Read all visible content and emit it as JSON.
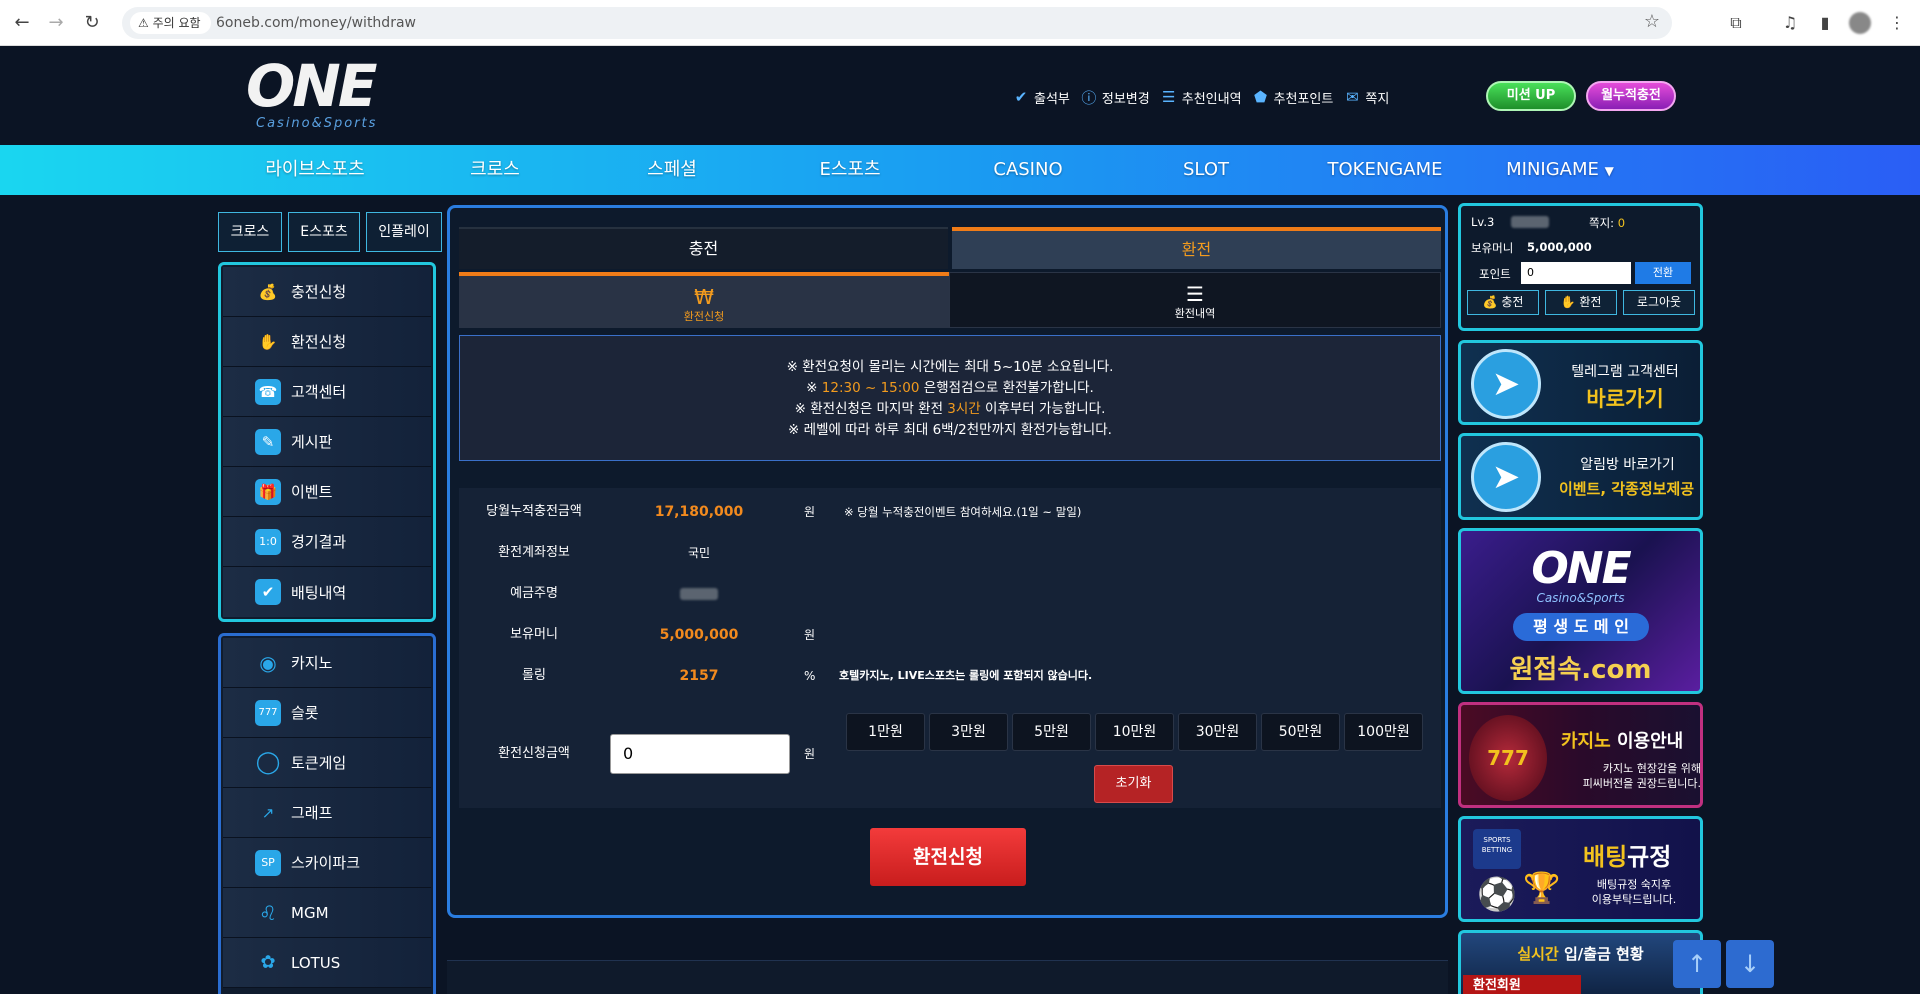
{
  "browser": {
    "warning": "주의 요함",
    "url": "6oneb.com/money/withdraw"
  },
  "logo": {
    "brand": "ONE",
    "tagline": "Casino&Sports"
  },
  "toplinks": [
    {
      "label": "출석부",
      "icon": "check-circle-icon"
    },
    {
      "label": "정보변경",
      "icon": "info-icon"
    },
    {
      "label": "추천인내역",
      "icon": "document-icon"
    },
    {
      "label": "추천포인트",
      "icon": "point-icon"
    },
    {
      "label": "쪽지",
      "icon": "mail-icon"
    }
  ],
  "pills": {
    "mission": "미션 UP",
    "monthly": "월누적충전"
  },
  "topnav": [
    "라이브스포츠",
    "크로스",
    "스페셜",
    "E스포츠",
    "CASINO",
    "SLOT",
    "TOKENGAME",
    "MINIGAME"
  ],
  "left_tabs": [
    "크로스",
    "E스포츠",
    "인플레이"
  ],
  "left_menu1": [
    {
      "label": "충전신청",
      "icon": "money-bag-icon"
    },
    {
      "label": "환전신청",
      "icon": "hand-coin-icon"
    },
    {
      "label": "고객센터",
      "icon": "phone-24-icon"
    },
    {
      "label": "게시판",
      "icon": "memo-icon"
    },
    {
      "label": "이벤트",
      "icon": "gift-icon"
    },
    {
      "label": "경기결과",
      "icon": "scoreboard-icon"
    },
    {
      "label": "배팅내역",
      "icon": "clipboard-check-icon"
    }
  ],
  "left_menu2": [
    {
      "label": "카지노",
      "icon": "chip-icon"
    },
    {
      "label": "슬롯",
      "icon": "slot-machine-icon"
    },
    {
      "label": "토큰게임",
      "icon": "ring-icon"
    },
    {
      "label": "그래프",
      "icon": "graph-icon"
    },
    {
      "label": "스카이파크",
      "icon": "skypark-icon"
    },
    {
      "label": "MGM",
      "icon": "lion-icon"
    },
    {
      "label": "LOTUS",
      "icon": "lotus-icon"
    }
  ],
  "main": {
    "tab_charge": "충전",
    "tab_withdraw": "환전",
    "subtab_request": "환전신청",
    "subtab_history": "환전내역",
    "notice": {
      "l1": "※ 환전요청이 몰리는 시간에는 최대 5~10분 소요됩니다.",
      "l2_pre": "※ ",
      "l2_hl": "12:30 ~ 15:00",
      "l2_post": " 은행점검으로 환전불가합니다.",
      "l3_pre": "※ 환전신청은 마지막 환전 ",
      "l3_hl": "3시간",
      "l3_post": " 이후부터 가능합니다.",
      "l4": "※ 레벨에 따라 하루 최대 6백/2천만까지 환전가능합니다."
    },
    "form": {
      "monthly_label": "당월누적충전금액",
      "monthly_value": "17,180,000",
      "won": "원",
      "monthly_note": "※ 당월 누적충전이벤트 참여하세요.(1일 ~ 말일)",
      "account_label": "환전계좌정보",
      "account_value": "국민",
      "holder_label": "예금주명",
      "balance_label": "보유머니",
      "balance_value": "5,000,000",
      "rolling_label": "롤링",
      "rolling_value": "2157",
      "percent": "%",
      "rolling_note": "호텔카지노, LIVE스포츠는 롤링에 포함되지 않습니다.",
      "amount_label": "환전신청금액",
      "amount_value": "0",
      "quick": [
        "1만원",
        "3만원",
        "5만원",
        "10만원",
        "30만원",
        "50만원",
        "100만원"
      ],
      "reset": "초기화"
    },
    "submit": "환전신청"
  },
  "user": {
    "level": "Lv.3",
    "msg_label": "쪽지:",
    "msg_count": "0",
    "money_label": "보유머니",
    "money_value": "5,000,000",
    "point_label": "포인트",
    "point_value": "0",
    "convert": "전환",
    "btn_charge": "충전",
    "btn_withdraw": "환전",
    "btn_logout": "로그아웃"
  },
  "banners": {
    "tg1_title": "텔레그램 고객센터",
    "tg1_sub": "바로가기",
    "tg2_title": "알림방 바로가기",
    "tg2_sub": "이벤트, 각종정보제공",
    "one_brand": "ONE",
    "one_tag": "Casino&Sports",
    "one_pill": "평 생 도 메 인",
    "one_domain": "원접속.com",
    "casino_title": "카지노",
    "casino_title2": " 이용안내",
    "casino_sub1": "카지노 현장감을 위해",
    "casino_sub2": "피씨버전을 권장드립니다.",
    "bet_tag": "SPORTS BETTING",
    "bet_title": "배팅",
    "bet_title2": "규정",
    "bet_sub1": "배팅규정 숙지후",
    "bet_sub2": "이용부탁드립니다."
  },
  "live": {
    "title_hl": "실시간",
    "title": " 입/출금 현황",
    "tab": "환전회원"
  },
  "colors": {
    "accent": "#f29b1e",
    "cyan": "#22c7de",
    "nav": "#1a9cf2",
    "submit": "#e22b2b"
  }
}
